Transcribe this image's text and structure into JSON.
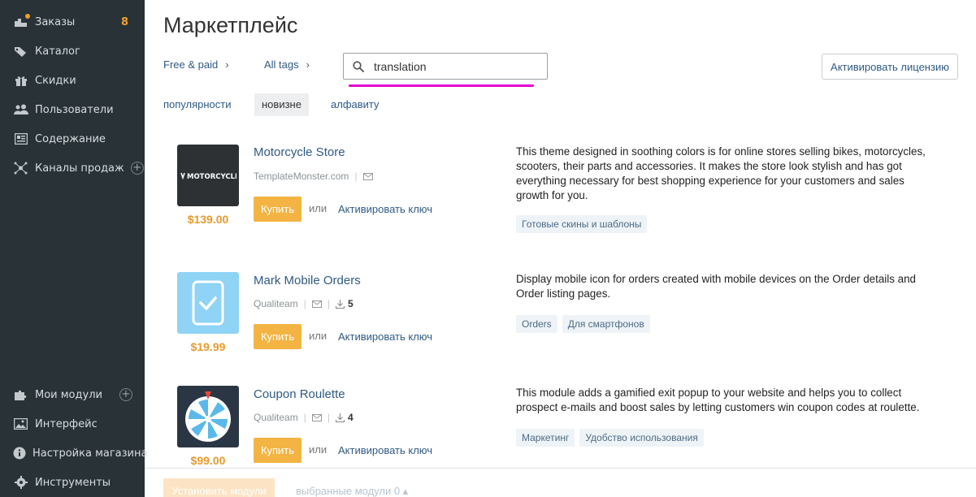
{
  "sidebar": {
    "items": [
      {
        "label": "Заказы",
        "icon": "orders-icon",
        "count": "8"
      },
      {
        "label": "Каталог",
        "icon": "tag-icon"
      },
      {
        "label": "Скидки",
        "icon": "gift-icon"
      },
      {
        "label": "Пользователи",
        "icon": "users-icon"
      },
      {
        "label": "Содержание",
        "icon": "content-icon"
      },
      {
        "label": "Каналы продаж",
        "icon": "sales-channels-icon"
      }
    ],
    "bottom_items": [
      {
        "label": "Мои модули",
        "icon": "puzzle-icon"
      },
      {
        "label": "Интерфейс",
        "icon": "image-icon"
      },
      {
        "label": "Настройка магазина",
        "icon": "info-icon"
      },
      {
        "label": "Инструменты",
        "icon": "gear-icon"
      }
    ],
    "accent_color": "#f0a030"
  },
  "header": {
    "title": "Маркетплейс",
    "filter_price": "Free & paid",
    "filter_tags": "All tags",
    "search_value": "translation",
    "activate_license": "Активировать лицензию"
  },
  "sort": {
    "popular": "популярности",
    "newest": "новизне",
    "alphabet": "алфавиту"
  },
  "products": [
    {
      "title": "Motorcycle Store",
      "vendor": "TemplateMonster.com",
      "downloads": "",
      "price": "$139.00",
      "buy": "Купить",
      "or": "или",
      "activate_key": "Активировать ключ",
      "thumb_text": "MOTORCYCLE",
      "description": "This theme designed in soothing colors is for online stores selling bikes, motorcycles, scooters, their parts and accessories. It makes the store look stylish and has got everything necessary for best shopping experience for your customers and sales growth for you.",
      "tags": [
        "Готовые скины и шаблоны"
      ]
    },
    {
      "title": "Mark Mobile Orders",
      "vendor": "Qualiteam",
      "downloads": "5",
      "price": "$19.99",
      "buy": "Купить",
      "or": "или",
      "activate_key": "Активировать ключ",
      "description": "Display mobile icon for orders created with mobile devices on the Order details and Order listing pages.",
      "tags": [
        "Orders",
        "Для смартфонов"
      ]
    },
    {
      "title": "Coupon Roulette",
      "vendor": "Qualiteam",
      "downloads": "4",
      "price": "$99.00",
      "buy": "Купить",
      "or": "или",
      "activate_key": "Активировать ключ",
      "description": "This module adds a gamified exit popup to your website and helps you to collect prospect e-mails and boost sales by letting customers win coupon codes at roulette.",
      "tags": [
        "Маркетинг",
        "Удобство использования"
      ]
    }
  ],
  "bottom_bar": {
    "install": "Установить модули",
    "selected": "выбранные модули 0 ▴"
  }
}
